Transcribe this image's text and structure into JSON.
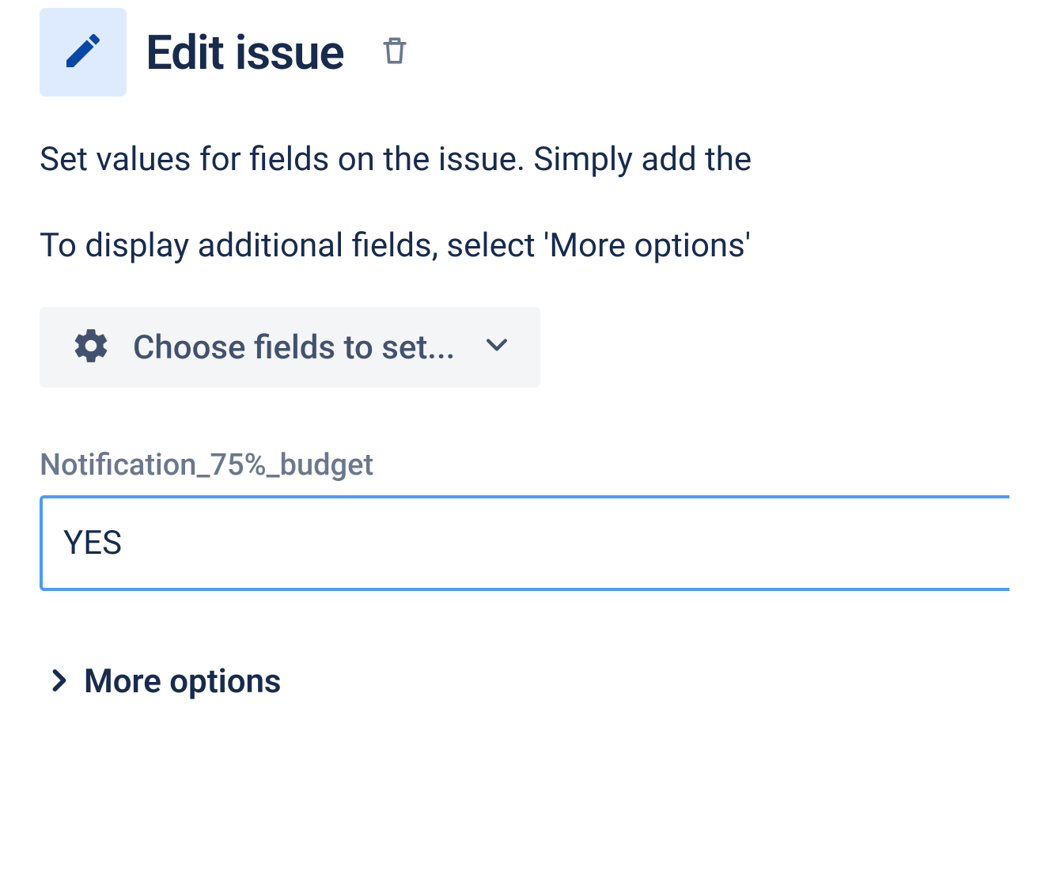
{
  "header": {
    "title": "Edit issue"
  },
  "description": {
    "line1": "Set values for fields on the issue. Simply add the",
    "line2": "To display additional fields, select 'More options'"
  },
  "chooseFields": {
    "label": "Choose fields to set..."
  },
  "field": {
    "label": "Notification_75%_budget",
    "value": "YES"
  },
  "moreOptions": {
    "label": "More options"
  }
}
